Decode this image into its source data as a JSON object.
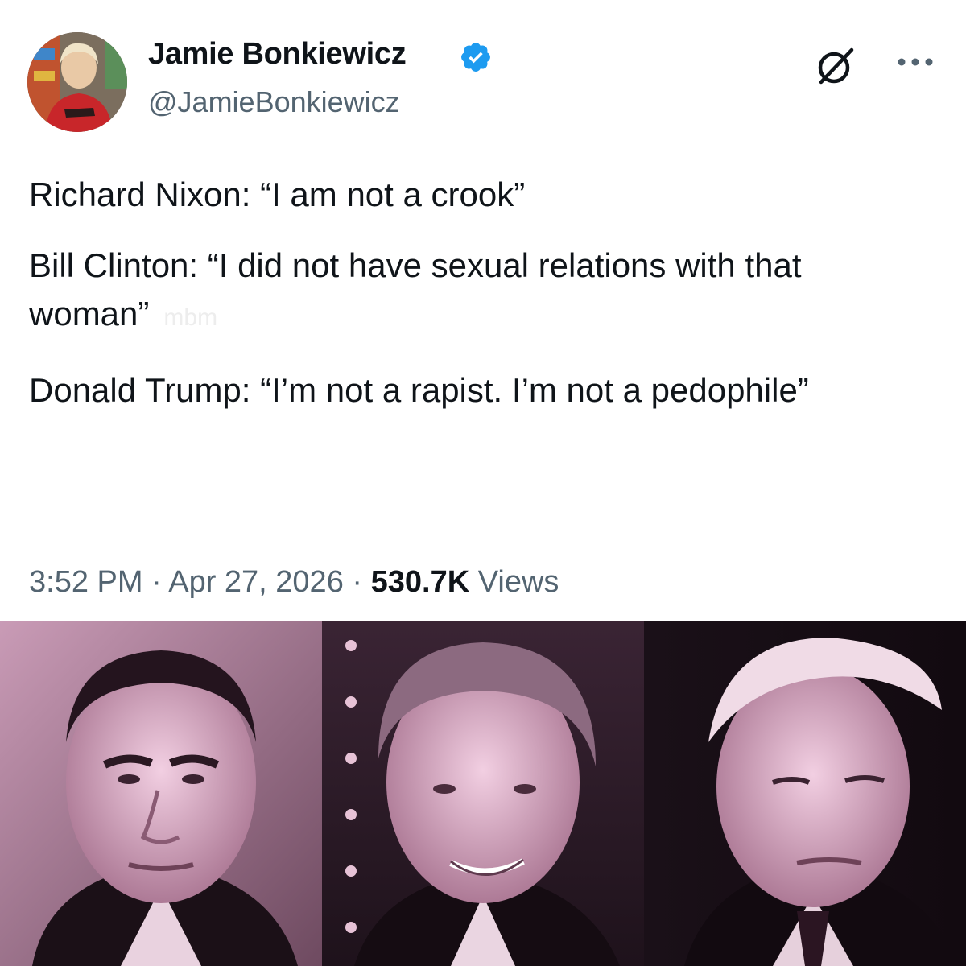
{
  "author": {
    "display_name": "Jamie Bonkiewicz",
    "handle": "@JamieBonkiewicz"
  },
  "icons": {
    "avatar": "profile-photo",
    "verified": "verified-badge-icon",
    "grok": "grok-icon",
    "more": "more-options-icon"
  },
  "tweet": {
    "lines": [
      "Richard Nixon: “I am not a crook”",
      "Bill Clinton: “I did not have sexual relations with that woman”",
      "Donald Trump: “I’m not a rapist. I’m not a pedophile”"
    ],
    "watermark": "mbm"
  },
  "meta": {
    "time": "3:52 PM",
    "separator": "·",
    "date": "Apr 27, 2026",
    "views_count": "530.7K",
    "views_label": "Views"
  },
  "colors": {
    "verified_blue": "#1d9bf0",
    "text_primary": "#0f1419",
    "text_secondary": "#536471",
    "photo_tint": "#e8b8d4"
  }
}
